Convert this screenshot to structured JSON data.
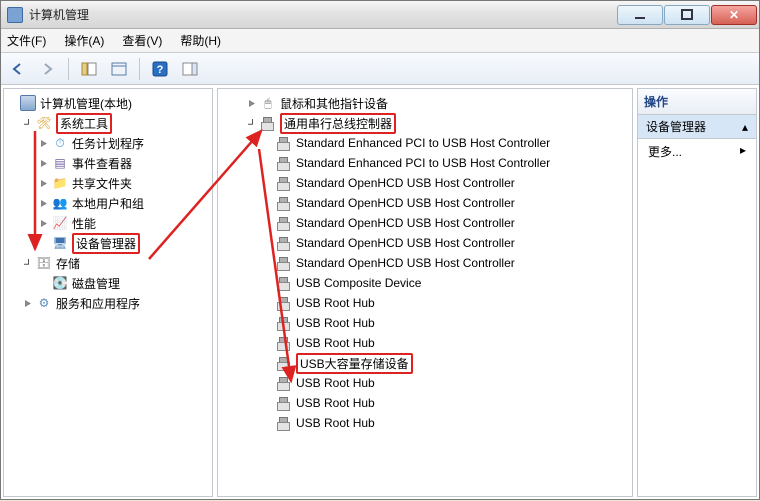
{
  "titlebar": {
    "title": "计算机管理"
  },
  "menus": {
    "file": "文件(F)",
    "action": "操作(A)",
    "view": "查看(V)",
    "help": "帮助(H)"
  },
  "actions_pane": {
    "header": "操作",
    "selected": "设备管理器",
    "more": "更多..."
  },
  "left_tree": {
    "root": "计算机管理(本地)",
    "system_tools": "系统工具",
    "tools": {
      "scheduler": "任务计划程序",
      "eventvwr": "事件查看器",
      "shares": "共享文件夹",
      "usersgrps": "本地用户和组",
      "perf": "性能",
      "devmgr": "设备管理器"
    },
    "storage": "存储",
    "diskmgmt": "磁盘管理",
    "services_apps": "服务和应用程序"
  },
  "center_tree": {
    "mouse_other": "鼠标和其他指针设备",
    "usb_controllers": "通用串行总线控制器",
    "items": [
      "Standard Enhanced PCI to USB Host Controller",
      "Standard Enhanced PCI to USB Host Controller",
      "Standard OpenHCD USB Host Controller",
      "Standard OpenHCD USB Host Controller",
      "Standard OpenHCD USB Host Controller",
      "Standard OpenHCD USB Host Controller",
      "Standard OpenHCD USB Host Controller",
      "USB Composite Device",
      "USB Root Hub",
      "USB Root Hub",
      "USB Root Hub",
      "USB大容量存储设备",
      "USB Root Hub",
      "USB Root Hub",
      "USB Root Hub"
    ],
    "highlight_index": 11
  }
}
